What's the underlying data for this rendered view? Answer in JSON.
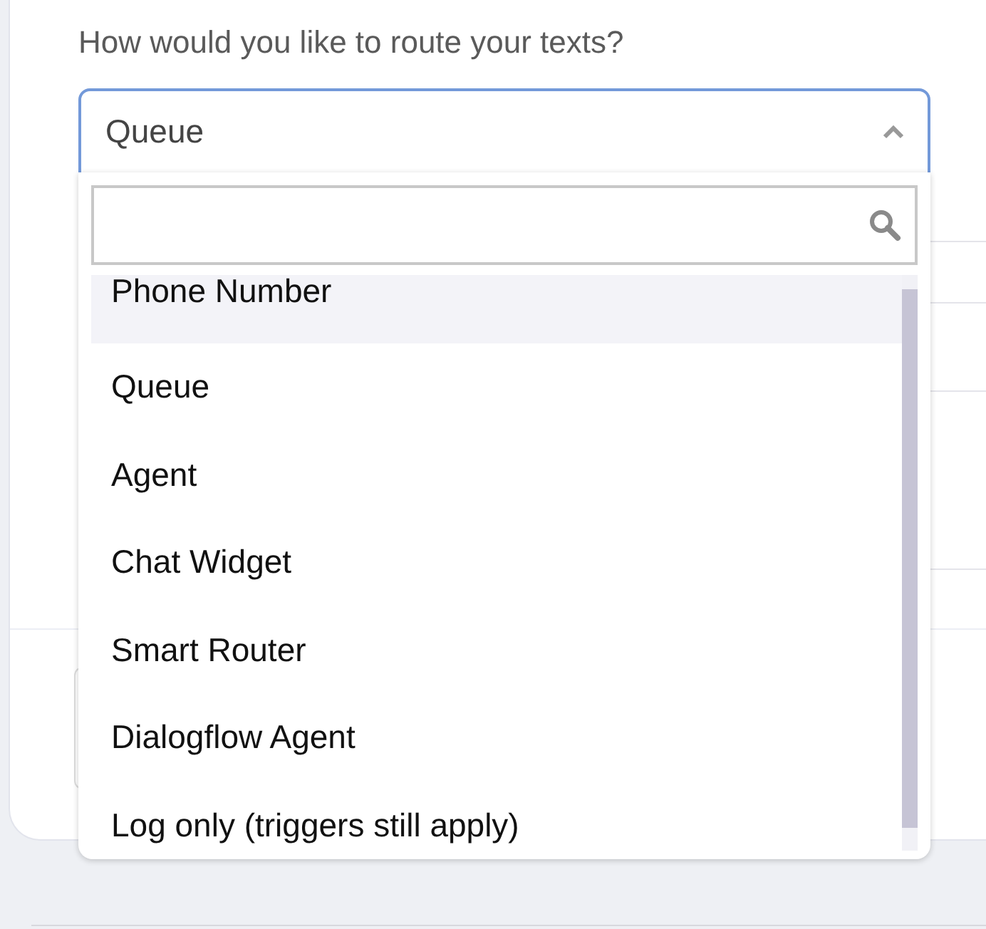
{
  "question": "How would you like to route your texts?",
  "select": {
    "value": "Queue",
    "expanded": true
  },
  "dropdown": {
    "options": [
      {
        "label": "Phone Number",
        "highlighted": true
      },
      {
        "label": "Queue",
        "highlighted": false
      },
      {
        "label": "Agent",
        "highlighted": false
      },
      {
        "label": "Chat Widget",
        "highlighted": false
      },
      {
        "label": "Smart Router",
        "highlighted": false
      },
      {
        "label": "Dialogflow Agent",
        "highlighted": false
      },
      {
        "label": "Log only (triggers still apply)",
        "highlighted": false
      }
    ]
  }
}
